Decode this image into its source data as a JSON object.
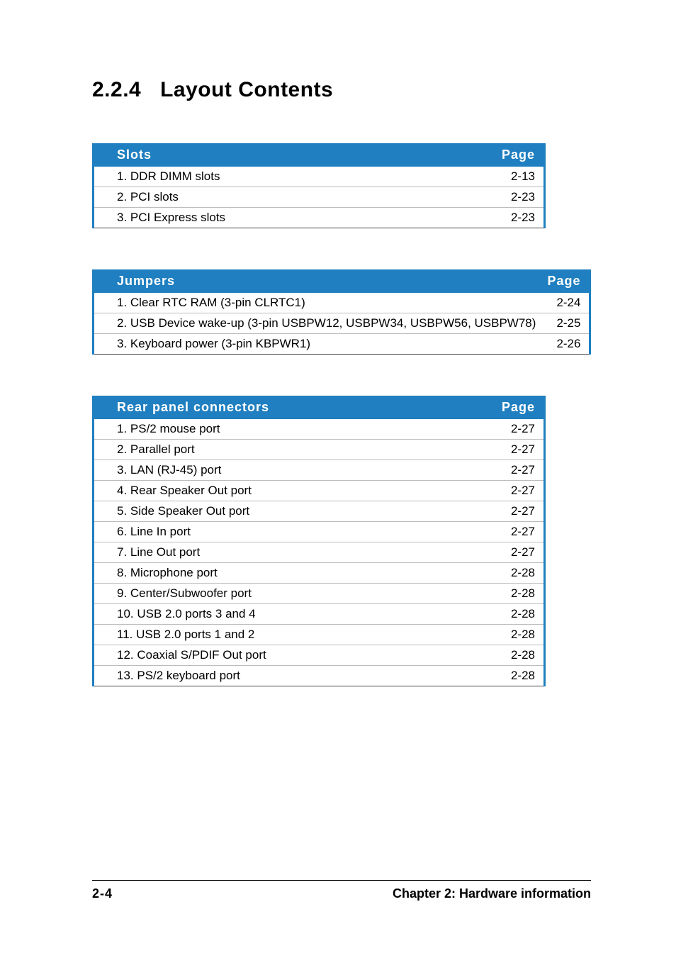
{
  "section": {
    "number": "2.2.4",
    "title": "Layout Contents"
  },
  "tables": [
    {
      "header": {
        "title": "Slots",
        "page": "Page"
      },
      "rows": [
        {
          "label": "1. DDR DIMM slots",
          "page": "2-13"
        },
        {
          "label": "2. PCI slots",
          "page": "2-23"
        },
        {
          "label": "3. PCI Express slots",
          "page": "2-23"
        }
      ]
    },
    {
      "header": {
        "title": "Jumpers",
        "page": "Page"
      },
      "rows": [
        {
          "label": "1. Clear RTC RAM (3-pin CLRTC1)",
          "page": "2-24"
        },
        {
          "label": "2. USB Device wake-up (3-pin USBPW12, USBPW34, USBPW56, USBPW78)",
          "page": "2-25"
        },
        {
          "label": "3. Keyboard power (3-pin KBPWR1)",
          "page": "2-26"
        }
      ]
    },
    {
      "header": {
        "title": "Rear panel connectors",
        "page": "Page"
      },
      "rows": [
        {
          "label": "1. PS/2 mouse port",
          "page": "2-27"
        },
        {
          "label": "2. Parallel port",
          "page": "2-27"
        },
        {
          "label": "3. LAN (RJ-45)  port",
          "page": "2-27"
        },
        {
          "label": "4. Rear Speaker Out port",
          "page": "2-27"
        },
        {
          "label": "5. Side Speaker Out port",
          "page": "2-27"
        },
        {
          "label": "6. Line In port",
          "page": "2-27"
        },
        {
          "label": "7. Line Out port",
          "page": "2-27"
        },
        {
          "label": "8. Microphone port",
          "page": "2-28"
        },
        {
          "label": "9. Center/Subwoofer port",
          "page": "2-28"
        },
        {
          "label": "10. USB 2.0 ports 3 and 4",
          "page": "2-28"
        },
        {
          "label": "11. USB 2.0 ports 1 and 2",
          "page": "2-28"
        },
        {
          "label": "12. Coaxial S/PDIF Out port",
          "page": "2-28"
        },
        {
          "label": "13. PS/2 keyboard port",
          "page": "2-28"
        }
      ]
    }
  ],
  "footer": {
    "pageNumber": "2-4",
    "chapter": "Chapter 2: Hardware information"
  }
}
